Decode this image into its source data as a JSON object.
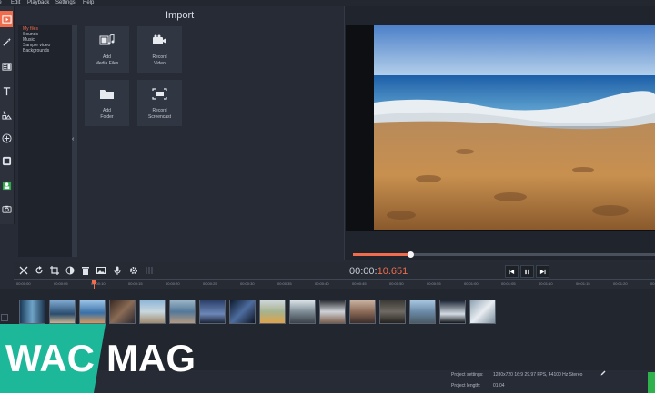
{
  "menu": [
    "le",
    "Edit",
    "Playback",
    "Settings",
    "Help"
  ],
  "import": {
    "title": "Import",
    "categories": [
      "My files",
      "Sounds",
      "Music",
      "Sample video",
      "Backgrounds"
    ],
    "active_category": "My files",
    "tiles": [
      {
        "line1": "Add",
        "line2": "Media Files",
        "icon": "media-files-icon"
      },
      {
        "line1": "Record",
        "line2": "Video",
        "icon": "video-camera-icon"
      },
      {
        "line1": "Add",
        "line2": "Folder",
        "icon": "folder-icon"
      },
      {
        "line1": "Record",
        "line2": "Screencast",
        "icon": "screencast-icon"
      }
    ]
  },
  "player": {
    "time_main": "00:00:",
    "time_sub": "10.651",
    "progress": 0.19,
    "controls": [
      "previous-icon",
      "pause-icon",
      "next-icon"
    ]
  },
  "timeline": {
    "ticks": [
      "00:00:00",
      "00:00:05",
      "00:00:10",
      "00:00:15",
      "00:00:20",
      "00:00:25",
      "00:00:30",
      "00:00:35",
      "00:00:40",
      "00:00:45",
      "00:00:50",
      "00:00:55",
      "00:01:00",
      "00:01:05",
      "00:01:10",
      "00:01:15",
      "00:01:20",
      "00:01:25"
    ],
    "clip_count": 16
  },
  "project": {
    "settings_label": "Project settings:",
    "settings_value": "1280x720 16:9 29.97 FPS, 44100 Hz Stereo",
    "length_label": "Project length:",
    "length_value": "01:04"
  },
  "watermark": {
    "left": "WAC",
    "right": "MAG"
  },
  "colors": {
    "accent": "#f06c4d",
    "watermark": "#1db89a",
    "export": "#2fb14b"
  }
}
